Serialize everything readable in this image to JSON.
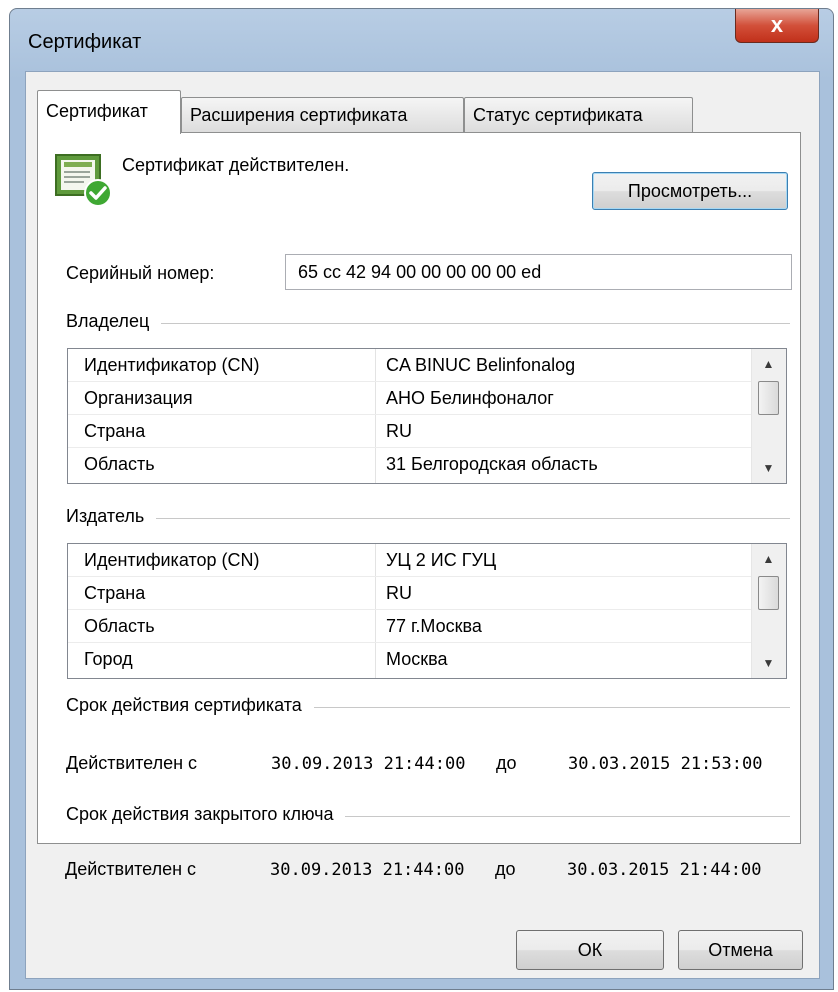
{
  "window": {
    "title": "Сертификат",
    "close_glyph": "x"
  },
  "tabs": [
    {
      "label": "Сертификат",
      "active": true
    },
    {
      "label": "Расширения сертификата",
      "active": false
    },
    {
      "label": "Статус сертификата",
      "active": false
    }
  ],
  "status": {
    "text": "Сертификат действителен.",
    "icon": "certificate-valid-icon"
  },
  "view_button": "Просмотреть...",
  "serial": {
    "label": "Серийный номер:",
    "value": "65 cc 42 94 00 00 00 00 00 ed"
  },
  "owner": {
    "title": "Владелец",
    "rows": [
      {
        "name": "Идентификатор (CN)",
        "value": "CA BINUC Belinfonalog"
      },
      {
        "name": "Организация",
        "value": "АНО Белинфоналог"
      },
      {
        "name": "Страна",
        "value": "RU"
      },
      {
        "name": "Область",
        "value": "31 Белгородская область"
      }
    ]
  },
  "issuer": {
    "title": "Издатель",
    "rows": [
      {
        "name": "Идентификатор (CN)",
        "value": "УЦ 2 ИС ГУЦ"
      },
      {
        "name": "Страна",
        "value": "RU"
      },
      {
        "name": "Область",
        "value": "77 г.Москва"
      },
      {
        "name": "Город",
        "value": "Москва"
      }
    ]
  },
  "cert_validity": {
    "title": "Срок действия сертификата",
    "from_label": "Действителен с",
    "from": "30.09.2013 21:44:00",
    "to_label": "до",
    "to": "30.03.2015 21:53:00"
  },
  "key_validity": {
    "title": "Срок действия закрытого ключа",
    "from_label": "Действителен с",
    "from": "30.09.2013 21:44:00",
    "to_label": "до",
    "to": "30.03.2015 21:44:00"
  },
  "buttons": {
    "ok": "ОК",
    "cancel": "Отмена"
  },
  "colors": {
    "title_bar": "#a9c1dc",
    "close_button": "#c1301a",
    "dialog_bg": "#f0f0f0",
    "focus_border": "#3c7fb1"
  }
}
